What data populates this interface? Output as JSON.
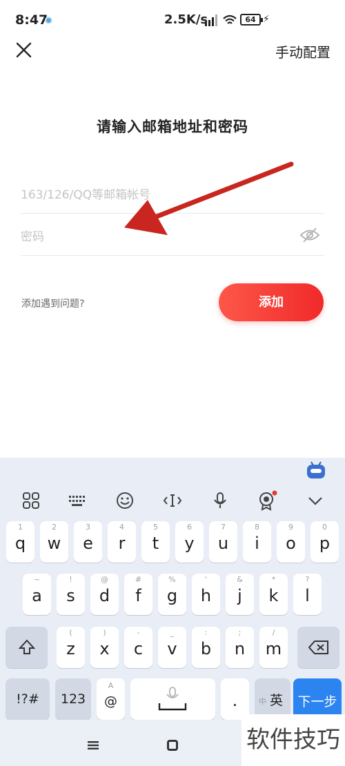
{
  "status_bar": {
    "time": "8:47",
    "net_speed": "2.5K/s",
    "battery": "64"
  },
  "header": {
    "manual_config": "手动配置"
  },
  "title": "请输入邮箱地址和密码",
  "form": {
    "email_placeholder": "163/126/QQ等邮箱帐号",
    "password_placeholder": "密码",
    "help_text": "添加遇到问题?",
    "add_button": "添加"
  },
  "keyboard": {
    "row1": [
      {
        "k": "q",
        "s": "1"
      },
      {
        "k": "w",
        "s": "2"
      },
      {
        "k": "e",
        "s": "3"
      },
      {
        "k": "r",
        "s": "4"
      },
      {
        "k": "t",
        "s": "5"
      },
      {
        "k": "y",
        "s": "6"
      },
      {
        "k": "u",
        "s": "7"
      },
      {
        "k": "i",
        "s": "8"
      },
      {
        "k": "o",
        "s": "9"
      },
      {
        "k": "p",
        "s": "0"
      }
    ],
    "row2": [
      {
        "k": "a",
        "s": "~"
      },
      {
        "k": "s",
        "s": "!"
      },
      {
        "k": "d",
        "s": "@"
      },
      {
        "k": "f",
        "s": "#"
      },
      {
        "k": "g",
        "s": "%"
      },
      {
        "k": "h",
        "s": "'"
      },
      {
        "k": "j",
        "s": "&"
      },
      {
        "k": "k",
        "s": "*"
      },
      {
        "k": "l",
        "s": "?"
      }
    ],
    "row3": [
      {
        "k": "z",
        "s": "("
      },
      {
        "k": "x",
        "s": ")"
      },
      {
        "k": "c",
        "s": "-"
      },
      {
        "k": "v",
        "s": "_"
      },
      {
        "k": "b",
        "s": ":"
      },
      {
        "k": "n",
        "s": ";"
      },
      {
        "k": "m",
        "s": "/"
      }
    ],
    "symbols_key": "!?#",
    "numbers_key": "123",
    "at_key": "@",
    "at_key_sub": "A",
    "period_key": ".",
    "lang_key": "英",
    "lang_key_sub": "中",
    "next_key": "下一步"
  },
  "watermark": "软件技巧"
}
